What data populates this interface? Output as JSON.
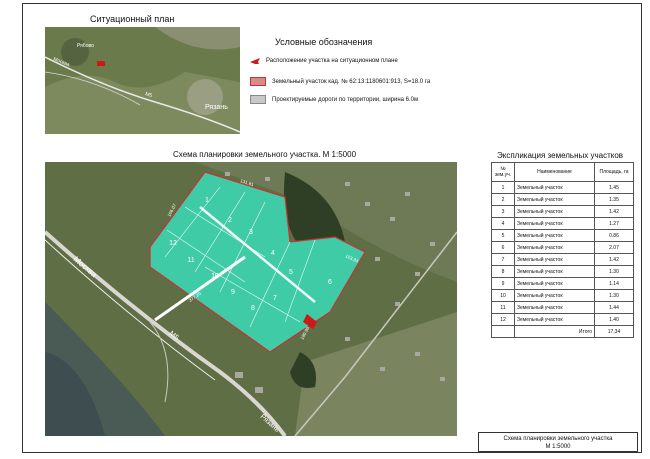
{
  "situation_plan": {
    "title": "Ситуационный план",
    "labels": {
      "ryabovo": "Рябово",
      "moskva": "Москва",
      "m5": "М5",
      "ryazan": "Рязань"
    }
  },
  "legend": {
    "title": "Условные обозначения",
    "items": [
      {
        "text": "Расположение участка на ситуационном плане",
        "color": "#cc1a1a"
      },
      {
        "text": "Земельный участок кад. № 62:13:1180601:913,  S=18.0 га",
        "color": "#d98a8a"
      },
      {
        "text": "Проектируемые дороги по территории, ширина 6.0м",
        "color": "#c8c8c8"
      }
    ]
  },
  "main_map": {
    "title": "Схема планировки земельного участка.  М 1:5000",
    "labels": {
      "moskva": "Москва",
      "m5": "М5",
      "ryazan": "Рязань"
    },
    "plot_color": "#3ecba6",
    "plot_border": "#c83232",
    "plot_numbers": [
      "1",
      "2",
      "3",
      "4",
      "5",
      "6",
      "7",
      "8",
      "9",
      "10",
      "11",
      "12"
    ],
    "dims": [
      "106.07",
      "131.81",
      "103.84",
      "377.20",
      "180.98"
    ]
  },
  "explication": {
    "title": "Экспликация земельных участков",
    "headers": [
      "№ зем.уч.",
      "Наименование",
      "Площадь, га"
    ],
    "rows": [
      {
        "num": "1",
        "name": "Земельный участок",
        "area": "1.45"
      },
      {
        "num": "2",
        "name": "Земельный участок",
        "area": "1.35"
      },
      {
        "num": "3",
        "name": "Земельный участок",
        "area": "1.42"
      },
      {
        "num": "4",
        "name": "Земельный участок",
        "area": "1.27"
      },
      {
        "num": "5",
        "name": "Земельный участок",
        "area": "0.86"
      },
      {
        "num": "6",
        "name": "Земельный участок",
        "area": "2.07"
      },
      {
        "num": "7",
        "name": "Земельный участок",
        "area": "1.42"
      },
      {
        "num": "8",
        "name": "Земельный участок",
        "area": "1.30"
      },
      {
        "num": "9",
        "name": "Земельный участок",
        "area": "1.14"
      },
      {
        "num": "10",
        "name": "Земельный участок",
        "area": "1.30"
      },
      {
        "num": "11",
        "name": "Земельный участок",
        "area": "1.44"
      },
      {
        "num": "12",
        "name": "Земельный участок",
        "area": "1.40"
      }
    ],
    "total_label": "Итого",
    "total_value": "17,34"
  },
  "stamp": {
    "line1": "Схема планировки земельного участка",
    "line2": "М 1:5000"
  }
}
